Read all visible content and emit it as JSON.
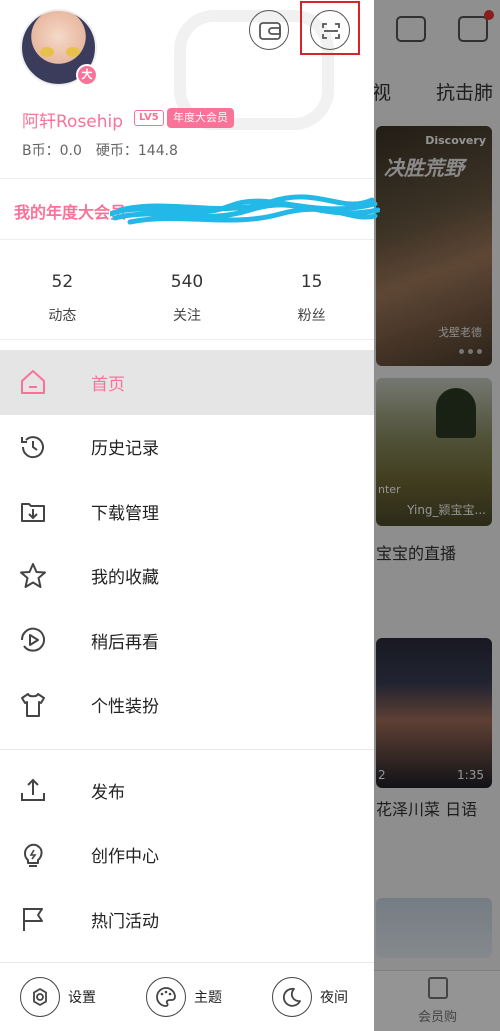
{
  "background_app": {
    "tabs": [
      "视",
      "抗击肺"
    ],
    "card1": {
      "logo": "Discovery",
      "title": "决胜荒野",
      "author": "戈壁老德"
    },
    "card2": {
      "overlay_left": "nter",
      "uploader": "Ying_颍宝宝..."
    },
    "card2_caption": "宝宝的直播",
    "card3": {
      "left_num": "2",
      "duration": "1:35"
    },
    "card3_caption": "花泽川菜 日语",
    "bottom_tab": "会员购"
  },
  "profile": {
    "username": "阿轩Rosehip",
    "level": "LV5",
    "vip_badge": "年度大会员",
    "b_coin": "B币：0.0",
    "coins": "硬币：144.8",
    "avatar_badge": "大"
  },
  "vip_banner": {
    "text": "我的年度大会员"
  },
  "stats": [
    {
      "value": "52",
      "label": "动态"
    },
    {
      "value": "540",
      "label": "关注"
    },
    {
      "value": "15",
      "label": "粉丝"
    }
  ],
  "menu": [
    {
      "label": "首页",
      "icon": "home-icon"
    },
    {
      "label": "历史记录",
      "icon": "history-icon"
    },
    {
      "label": "下载管理",
      "icon": "download-icon"
    },
    {
      "label": "我的收藏",
      "icon": "star-icon"
    },
    {
      "label": "稍后再看",
      "icon": "watch-later-icon"
    },
    {
      "label": "个性装扮",
      "icon": "tshirt-icon"
    }
  ],
  "menu2": [
    {
      "label": "发布",
      "icon": "upload-icon"
    },
    {
      "label": "创作中心",
      "icon": "bulb-icon"
    },
    {
      "label": "热门活动",
      "icon": "flag-icon"
    }
  ],
  "bottom": [
    {
      "label": "设置",
      "icon": "settings-icon"
    },
    {
      "label": "主题",
      "icon": "palette-icon"
    },
    {
      "label": "夜间",
      "icon": "moon-icon"
    }
  ],
  "colors": {
    "accent": "#fb7299",
    "highlight_box": "#d9232a"
  }
}
